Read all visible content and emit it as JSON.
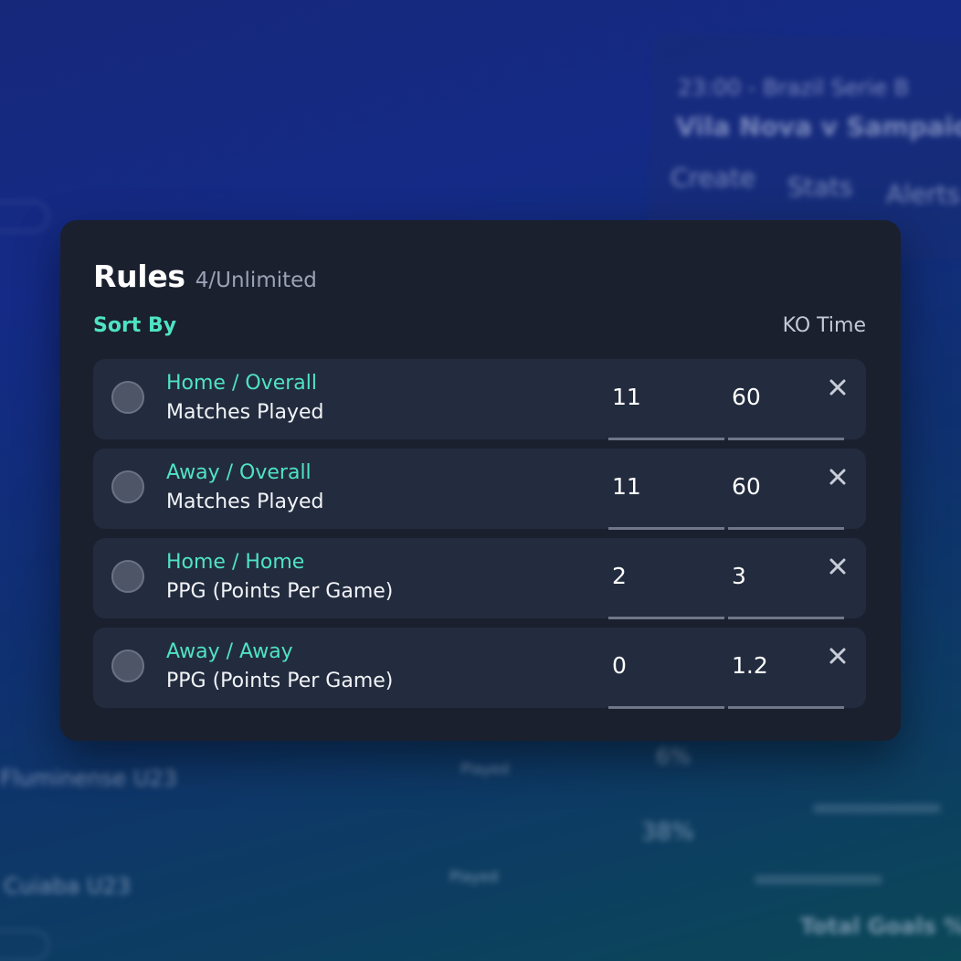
{
  "background": {
    "match_time_league": "23:00 - Brazil Serie B",
    "match_teams": "Vila Nova v Sampaio",
    "tabs": [
      "Create",
      "Stats",
      "Alerts"
    ],
    "team_names": [
      "Fluminense U23",
      "Cuiaba U23"
    ],
    "played_label": "Played",
    "percents": [
      "6%",
      "38%"
    ],
    "total_goals": "Total Goals %"
  },
  "card": {
    "title": "Rules",
    "count": "4/Unlimited",
    "sort_by_label": "Sort By",
    "sort_value": "KO Time"
  },
  "rules": [
    {
      "category": "Home / Overall",
      "metric": "Matches Played",
      "min": "11",
      "max": "60"
    },
    {
      "category": "Away / Overall",
      "metric": "Matches Played",
      "min": "11",
      "max": "60"
    },
    {
      "category": "Home / Home",
      "metric": "PPG (Points Per Game)",
      "min": "2",
      "max": "3"
    },
    {
      "category": "Away / Away",
      "metric": "PPG (Points Per Game)",
      "min": "0",
      "max": "1.2"
    }
  ],
  "colors": {
    "accent": "#4fe3c3",
    "card_bg": "#1a202e",
    "row_bg": "#232c3e"
  },
  "icons": {
    "remove": "close-icon",
    "select": "radio-button"
  }
}
